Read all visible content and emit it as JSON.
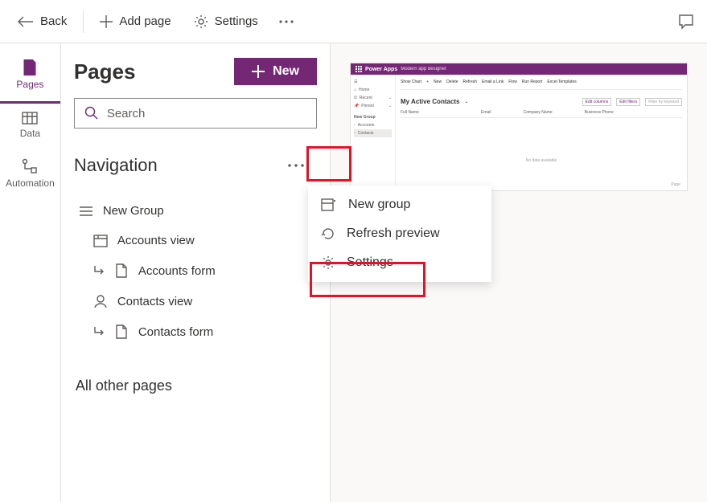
{
  "toolbar": {
    "back": "Back",
    "add_page": "Add page",
    "settings": "Settings"
  },
  "sidebar": {
    "pages": "Pages",
    "data": "Data",
    "automation": "Automation"
  },
  "panel": {
    "title": "Pages",
    "new_button": "New",
    "search_placeholder": "Search",
    "navigation_header": "Navigation",
    "new_group": "New Group",
    "items": [
      {
        "label": "Accounts view",
        "type": "view",
        "level": 1
      },
      {
        "label": "Accounts form",
        "type": "form",
        "level": 2
      },
      {
        "label": "Contacts view",
        "type": "contacts-view",
        "level": 1
      },
      {
        "label": "Contacts form",
        "type": "form",
        "level": 2
      }
    ],
    "all_pages": "All other pages"
  },
  "context_menu": {
    "new_group": "New group",
    "refresh_preview": "Refresh preview",
    "settings": "Settings"
  },
  "preview": {
    "brand": "Power Apps",
    "brand_sub": "Modern app designer",
    "side_items": [
      "Home",
      "Recent",
      "Pinned"
    ],
    "side_group": "New Group",
    "side_group_items": [
      "Accounts",
      "Contacts"
    ],
    "cmdbar": [
      "Show Chart",
      "New",
      "Delete",
      "Refresh",
      "Email a Link",
      "Flow",
      "Run Report",
      "Excel Templates"
    ],
    "actions": [
      "Edit columns",
      "Edit filters"
    ],
    "filter_placeholder": "Filter by keyword",
    "view_title": "My Active Contacts",
    "cols": [
      "Full Name",
      "Email",
      "Company Name",
      "Business Phone"
    ],
    "empty": "No data available",
    "page": "Page"
  }
}
